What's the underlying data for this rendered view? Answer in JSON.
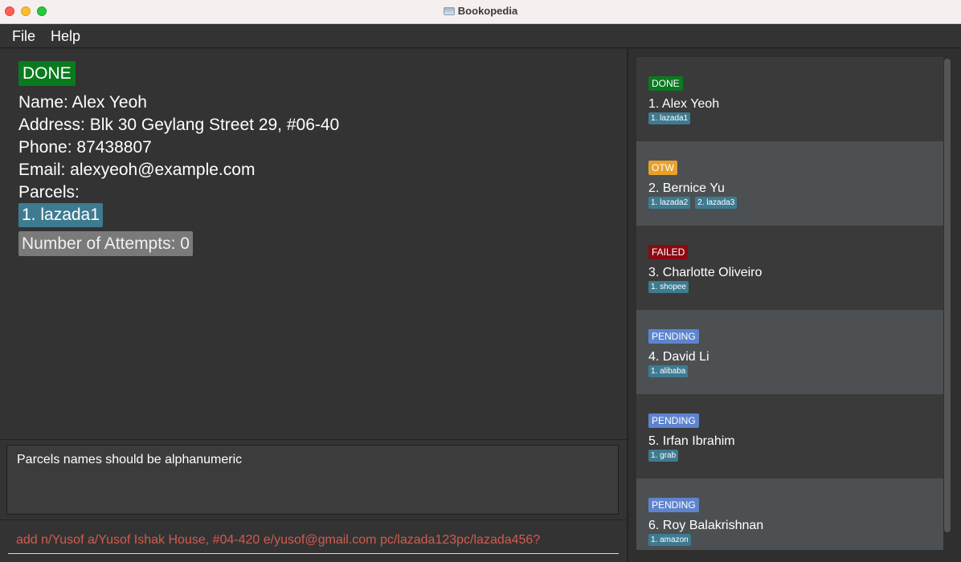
{
  "window": {
    "title": "Bookopedia"
  },
  "menu": {
    "file": "File",
    "help": "Help"
  },
  "detail": {
    "status": "DONE",
    "name": "Name: Alex Yeoh",
    "address": "Address: Blk 30 Geylang Street 29, #06-40",
    "phone": "Phone: 87438807",
    "email": "Email: alexyeoh@example.com",
    "parcels_label": "Parcels:",
    "parcel": "1. lazada1",
    "attempts": "Number of Attempts: 0"
  },
  "result": {
    "message": "Parcels names should be alphanumeric"
  },
  "command": {
    "value": "add n/Yusof a/Yusof Ishak House, #04-420 e/yusof@gmail.com pc/lazada123pc/lazada456?"
  },
  "colors": {
    "done": "#0a7a1f",
    "otw": "#e8a02a",
    "failed": "#8a0a12",
    "pending": "#5e84cf",
    "parcel": "#3e7b91",
    "command_text": "#d25b4f"
  },
  "list": [
    {
      "status": "DONE",
      "status_class": "done",
      "name": "1.  Alex Yeoh",
      "parcels": [
        "1. lazada1"
      ]
    },
    {
      "status": "OTW",
      "status_class": "otw",
      "name": "2.  Bernice Yu",
      "parcels": [
        "1. lazada2",
        "2. lazada3"
      ]
    },
    {
      "status": "FAILED",
      "status_class": "failed",
      "name": "3.  Charlotte Oliveiro",
      "parcels": [
        "1. shopee"
      ]
    },
    {
      "status": "PENDING",
      "status_class": "pending",
      "name": "4.  David Li",
      "parcels": [
        "1. alibaba"
      ]
    },
    {
      "status": "PENDING",
      "status_class": "pending",
      "name": "5.  Irfan Ibrahim",
      "parcels": [
        "1. grab"
      ]
    },
    {
      "status": "PENDING",
      "status_class": "pending",
      "name": "6.  Roy Balakrishnan",
      "parcels": [
        "1. amazon"
      ]
    }
  ]
}
